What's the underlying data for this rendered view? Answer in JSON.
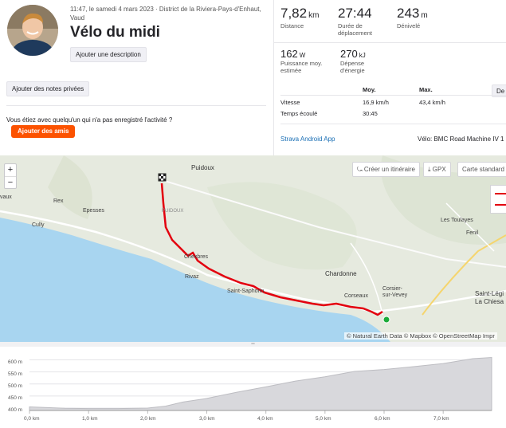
{
  "header": {
    "meta_line": "11:47, le samedi 4 mars 2023 · District de la Riviera-Pays-d'Enhaut, Vaud",
    "title": "Vélo du midi",
    "add_description": "Ajouter une description",
    "add_notes": "Ajouter des notes privées",
    "question": "Vous étiez avec quelqu'un qui n'a pas enregistré l'activité ?",
    "add_friends": "Ajouter des amis"
  },
  "stats": {
    "distance": {
      "value": "7,82",
      "unit": "km",
      "label": "Distance"
    },
    "moving_time": {
      "value": "27:44",
      "label": "Durée de déplacement"
    },
    "elevation": {
      "value": "243",
      "unit": "m",
      "label": "Dénivelé"
    },
    "power": {
      "value": "162",
      "unit": "W",
      "label": "Puissance moy. estimée"
    },
    "energy": {
      "value": "270",
      "unit": "kJ",
      "label": "Dépense d'énergie"
    },
    "table": {
      "col_avg": "Moy.",
      "col_max": "Max.",
      "speed_label": "Vitesse",
      "speed_avg": "16,9 km/h",
      "speed_max": "43,4 km/h",
      "elapsed_label": "Temps écoulé",
      "elapsed_value": "30:45"
    },
    "more_button": "De",
    "source": "Strava Android App",
    "bike": "Vélo: BMC Road Machine IV 1"
  },
  "map": {
    "zoom_in": "+",
    "zoom_out": "−",
    "create_route": "Créer un itinéraire",
    "gpx": "GPX",
    "map_style": "Carte standard",
    "attribution": "© Natural Earth Data © Mapbox © OpenStreetMap Impr",
    "places": {
      "puidoux": "Puidoux",
      "rex": "Rex",
      "epesses": "Epesses",
      "cully": "Cully",
      "vaux": "vaux",
      "chexbres": "Chexbres",
      "rivaz": "Rivaz",
      "saint_saphorin": "Saint-Saphorin",
      "chardonne": "Chardonne",
      "corseaux": "Corseaux",
      "corsier": "Corsier-sur-Vevey",
      "les_toulayes": "Les Toulayes",
      "fenil": "Fenil",
      "saint_legier": "Saint-Légi La Chiesa",
      "puidoux_area": "PUIDOUX"
    },
    "route_color": "#e3000f",
    "lake_color": "#a8d5f0"
  },
  "elevation_chart": {
    "y_ticks": [
      "600 m",
      "550 m",
      "500 m",
      "450 m",
      "400 m"
    ],
    "x_ticks": [
      "0,0 km",
      "1,0 km",
      "2,0 km",
      "3,0 km",
      "4,0 km",
      "5,0 km",
      "6,0 km",
      "7,0 km"
    ]
  },
  "chart_data": {
    "type": "area",
    "xlabel": "",
    "ylabel": "",
    "x": [
      0,
      0.3,
      0.6,
      1.0,
      1.5,
      2.0,
      2.3,
      2.6,
      3.0,
      3.5,
      4.0,
      4.5,
      5.0,
      5.5,
      6.0,
      6.5,
      7.0,
      7.5,
      7.82
    ],
    "values": [
      405,
      402,
      399,
      398,
      398,
      400,
      408,
      425,
      440,
      465,
      488,
      512,
      530,
      552,
      560,
      572,
      585,
      605,
      610
    ],
    "ylim": [
      390,
      615
    ],
    "xlim": [
      0,
      7.82
    ],
    "grid": true
  }
}
